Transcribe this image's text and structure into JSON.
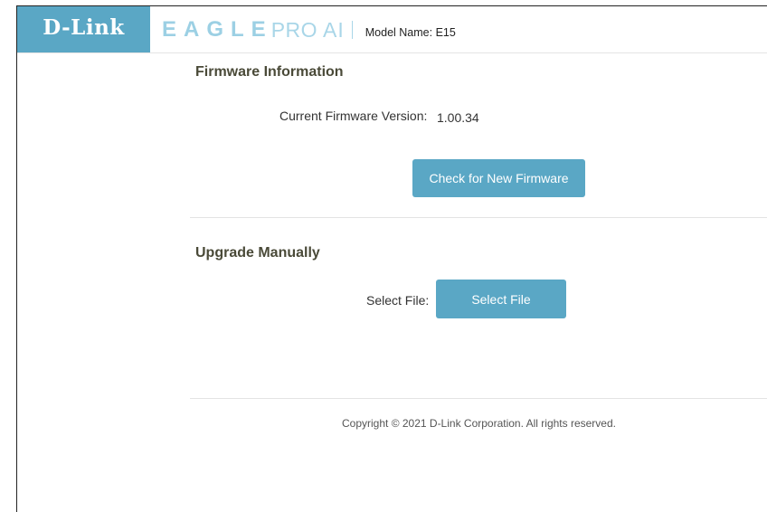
{
  "header": {
    "brand": "D-Link",
    "product_eagle": "EAGLE",
    "product_pro": "PRO",
    "product_ai": "AI",
    "model_label": "Model Name: E15"
  },
  "firmware_info": {
    "title": "Firmware Information",
    "current_version_label": "Current Firmware Version:",
    "current_version_value": "1.00.34",
    "check_button_label": "Check for New Firmware"
  },
  "upgrade_manually": {
    "title": "Upgrade Manually",
    "select_file_label": "Select File:",
    "select_file_button_label": "Select File"
  },
  "footer": {
    "copyright": "Copyright © 2021 D-Link Corporation. All rights reserved."
  },
  "colors": {
    "accent": "#5aa7c5",
    "product_title": "#9cd0e4",
    "section_title": "#4a4a38"
  }
}
